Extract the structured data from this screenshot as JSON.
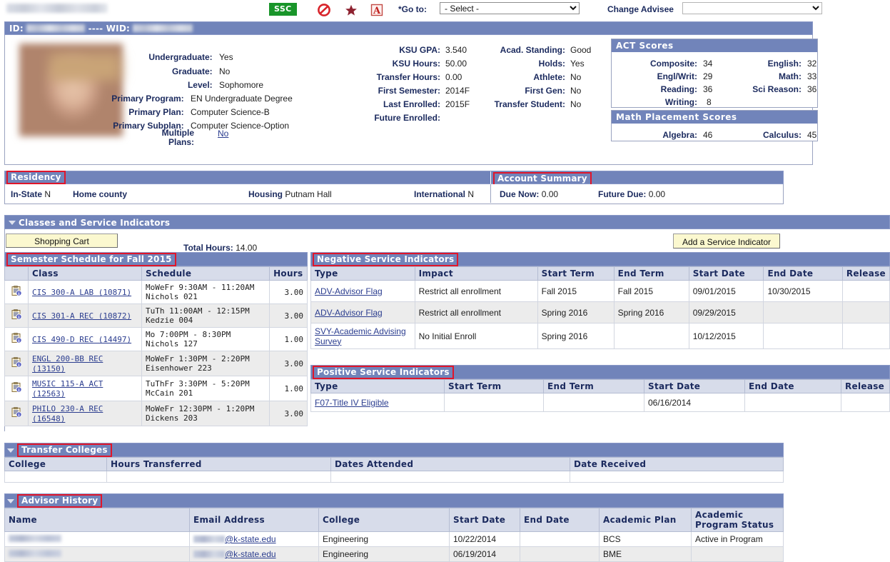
{
  "toolbar": {
    "ssc_badge": "SSC",
    "goto_label": "*Go to:",
    "goto_value": "- Select -",
    "change_advisee_label": "Change Advisee",
    "change_advisee_value": "",
    "icons": [
      "no-entry-icon",
      "star-icon",
      "a-flag-icon"
    ]
  },
  "id_bar": {
    "id_label": "ID:",
    "separator": "----",
    "wid_label": "WID:"
  },
  "student": {
    "email_domain": "@k-state.edu",
    "fields_left": [
      {
        "label": "Undergraduate:",
        "value": "Yes"
      },
      {
        "label": "Graduate:",
        "value": "No"
      },
      {
        "label": "Level:",
        "value": "Sophomore"
      },
      {
        "label": "Primary Program:",
        "value": "EN Undergraduate Degree"
      },
      {
        "label": "Primary Plan:",
        "value": "Computer Science-B"
      },
      {
        "label": "Primary Subplan:",
        "value": "Computer Science-Option"
      },
      {
        "label": "Multiple Plans:",
        "value": "No"
      }
    ],
    "fields_mid": [
      {
        "label": "KSU GPA:",
        "value": "3.540"
      },
      {
        "label": "KSU Hours:",
        "value": "50.00"
      },
      {
        "label": "Transfer Hours:",
        "value": "0.00"
      },
      {
        "label": "First Semester:",
        "value": "2014F"
      },
      {
        "label": "Last Enrolled:",
        "value": "2015F"
      },
      {
        "label": "Future Enrolled:",
        "value": ""
      }
    ],
    "fields_right": [
      {
        "label": "Acad. Standing:",
        "value": "Good"
      },
      {
        "label": "Holds:",
        "value": "Yes"
      },
      {
        "label": "Athlete:",
        "value": "No"
      },
      {
        "label": "First Gen:",
        "value": "No"
      },
      {
        "label": "Transfer Student:",
        "value": "No"
      }
    ]
  },
  "act_scores": {
    "title": "ACT Scores",
    "rows": [
      {
        "l1": "Composite:",
        "v1": "34",
        "l2": "English:",
        "v2": "32"
      },
      {
        "l1": "Engl/Writ:",
        "v1": "29",
        "l2": "Math:",
        "v2": "33"
      },
      {
        "l1": "Reading:",
        "v1": "36",
        "l2": "Sci Reason:",
        "v2": "36"
      },
      {
        "l1": "Writing:",
        "v1": "8",
        "l2": "",
        "v2": ""
      }
    ]
  },
  "math_placement": {
    "title": "Math Placement Scores",
    "rows": [
      {
        "l1": "Algebra:",
        "v1": "46",
        "l2": "Calculus:",
        "v2": "45"
      }
    ]
  },
  "residency": {
    "title": "Residency",
    "in_state_label": "In-State",
    "in_state_value": "N",
    "home_county_label": "Home county",
    "home_county_value": "",
    "housing_label": "Housing",
    "housing_value": "Putnam Hall",
    "international_label": "International",
    "international_value": "N"
  },
  "account_summary": {
    "title": "Account Summary",
    "due_now_label": "Due Now:",
    "due_now_value": "0.00",
    "future_due_label": "Future Due:",
    "future_due_value": "0.00"
  },
  "classes_section": {
    "title": "Classes and Service Indicators",
    "shopping_cart_button": "Shopping Cart",
    "add_service_indicator_button": "Add a Service Indicator",
    "total_hours_label": "Total Hours:",
    "total_hours_value": "14.00"
  },
  "semester_schedule": {
    "title": "Semester Schedule for Fall 2015",
    "columns": [
      "",
      "Class",
      "Schedule",
      "Hours"
    ],
    "rows": [
      {
        "class": "CIS 300-A LAB (10871)",
        "schedule_line1": "MoWeFr 9:30AM - 11:20AM",
        "schedule_line2": "Nichols 021",
        "hours": "3.00"
      },
      {
        "class": "CIS 301-A REC (10872)",
        "schedule_line1": "TuTh 11:00AM - 12:15PM",
        "schedule_line2": "Kedzie 004",
        "hours": "3.00"
      },
      {
        "class": "CIS 490-D REC (14497)",
        "schedule_line1": "Mo 7:00PM - 8:30PM",
        "schedule_line2": "Nichols 127",
        "hours": "1.00"
      },
      {
        "class": "ENGL 200-BB REC (13150)",
        "schedule_line1": "MoWeFr 1:30PM - 2:20PM",
        "schedule_line2": "Eisenhower 223",
        "hours": "3.00"
      },
      {
        "class": "MUSIC 115-A ACT (12563)",
        "schedule_line1": "TuThFr 3:30PM - 5:20PM",
        "schedule_line2": "McCain 201",
        "hours": "1.00"
      },
      {
        "class": "PHILO 230-A REC (16548)",
        "schedule_line1": "MoWeFr 12:30PM - 1:20PM",
        "schedule_line2": "Dickens 203",
        "hours": "3.00"
      }
    ]
  },
  "negative_service_indicators": {
    "title": "Negative Service Indicators",
    "columns": [
      "Type",
      "Impact",
      "Start Term",
      "End Term",
      "Start Date",
      "End Date",
      "Release"
    ],
    "rows": [
      {
        "type": "ADV-Advisor Flag",
        "impact": "Restrict all enrollment",
        "start_term": "Fall 2015",
        "end_term": "Fall 2015",
        "start_date": "09/01/2015",
        "end_date": "10/30/2015",
        "release": ""
      },
      {
        "type": "ADV-Advisor Flag",
        "impact": "Restrict all enrollment",
        "start_term": "Spring 2016",
        "end_term": "Spring 2016",
        "start_date": "09/29/2015",
        "end_date": "",
        "release": ""
      },
      {
        "type": "SVY-Academic Advising Survey",
        "impact": "No Initial Enroll",
        "start_term": "Spring 2016",
        "end_term": "",
        "start_date": "10/12/2015",
        "end_date": "",
        "release": ""
      }
    ]
  },
  "positive_service_indicators": {
    "title": "Positive Service Indicators",
    "columns": [
      "Type",
      "Start Term",
      "End Term",
      "Start Date",
      "End Date",
      "Release"
    ],
    "rows": [
      {
        "type": "F07-Title IV Eligible",
        "start_term": "",
        "end_term": "",
        "start_date": "06/16/2014",
        "end_date": "",
        "release": ""
      }
    ]
  },
  "transfer_colleges": {
    "title": "Transfer Colleges",
    "columns": [
      "College",
      "Hours Transferred",
      "Dates Attended",
      "Date Received"
    ],
    "rows": [
      {
        "college": "",
        "hours": "",
        "dates": "",
        "received": ""
      }
    ]
  },
  "advisor_history": {
    "title": "Advisor History",
    "columns": [
      "Name",
      "Email Address",
      "College",
      "Start Date",
      "End Date",
      "Academic Plan",
      "Academic Program Status"
    ],
    "rows": [
      {
        "name": "",
        "email": "@k-state.edu",
        "college": "Engineering",
        "start_date": "10/22/2014",
        "end_date": "",
        "plan": "BCS",
        "status": "Active in Program"
      },
      {
        "name": "",
        "email": "@k-state.edu",
        "college": "Engineering",
        "start_date": "06/19/2014",
        "end_date": "",
        "plan": "BME",
        "status": ""
      }
    ]
  },
  "colors": {
    "header_blue": "#7184ba",
    "label_navy": "#1b2a5e",
    "link_blue": "#2b3d8f",
    "highlight_red": "#e0152a",
    "button_yellow": "#fbf8cf",
    "ssc_green": "#19952a",
    "table_header": "#d7dcea"
  }
}
